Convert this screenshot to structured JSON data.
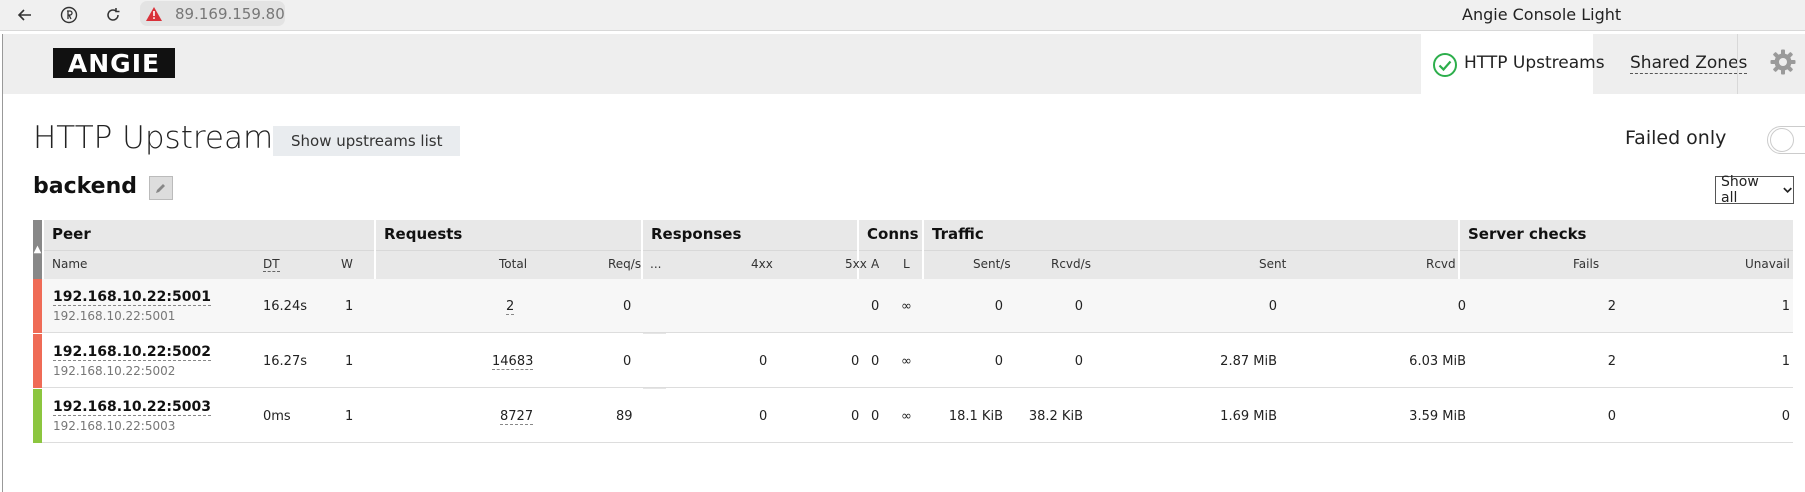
{
  "browser": {
    "address": "89.169.159.80",
    "window_title": "Angie Console Light"
  },
  "header": {
    "logo": "ANGIE",
    "nav": [
      {
        "label": "HTTP Upstreams",
        "active": true
      },
      {
        "label": "Shared Zones",
        "active": false
      }
    ]
  },
  "page": {
    "title": "HTTP Upstreams",
    "show_list_button": "Show upstreams list",
    "failed_only_label": "Failed only",
    "failed_only": false,
    "upstream_name": "backend",
    "filter_select": "Show all"
  },
  "table": {
    "groups": {
      "peer": "Peer",
      "requests": "Requests",
      "responses": "Responses",
      "conns": "Conns",
      "traffic": "Traffic",
      "server_checks": "Server checks"
    },
    "columns": {
      "name": "Name",
      "dt": "DT",
      "w": "W",
      "total": "Total",
      "req_s": "Req/s",
      "more": "...",
      "r4xx": "4xx",
      "r5xx": "5xx",
      "a": "A",
      "l": "L",
      "sent_s": "Sent/s",
      "rcvd_s": "Rcvd/s",
      "sent": "Sent",
      "rcvd": "Rcvd",
      "fails": "Fails",
      "unavail": "Unavail"
    },
    "expand_arrow": "▶",
    "sort_indicator": "▲",
    "rows": [
      {
        "name": "192.168.10.22:5001",
        "addr": "192.168.10.22:5001",
        "status": "down",
        "status_color": "#ef6b56",
        "dt": "16.24s",
        "w": "1",
        "total": "2",
        "req_s": "0",
        "r4xx": "",
        "r5xx": "",
        "a": "0",
        "l": "∞",
        "sent_s": "0",
        "rcvd_s": "0",
        "sent": "0",
        "rcvd": "0",
        "fails": "2",
        "unavail": "1"
      },
      {
        "name": "192.168.10.22:5002",
        "addr": "192.168.10.22:5002",
        "status": "down",
        "status_color": "#ef6b56",
        "dt": "16.27s",
        "w": "1",
        "total": "14683",
        "req_s": "0",
        "r4xx": "0",
        "r5xx": "0",
        "a": "0",
        "l": "∞",
        "sent_s": "0",
        "rcvd_s": "0",
        "sent": "2.87 MiB",
        "rcvd": "6.03 MiB",
        "fails": "2",
        "unavail": "1"
      },
      {
        "name": "192.168.10.22:5003",
        "addr": "192.168.10.22:5003",
        "status": "up",
        "status_color": "#8cc63f",
        "dt": "0ms",
        "w": "1",
        "total": "8727",
        "req_s": "89",
        "r4xx": "0",
        "r5xx": "0",
        "a": "0",
        "l": "∞",
        "sent_s": "18.1 KiB",
        "rcvd_s": "38.2 KiB",
        "sent": "1.69 MiB",
        "rcvd": "3.59 MiB",
        "fails": "0",
        "unavail": "0"
      }
    ]
  }
}
